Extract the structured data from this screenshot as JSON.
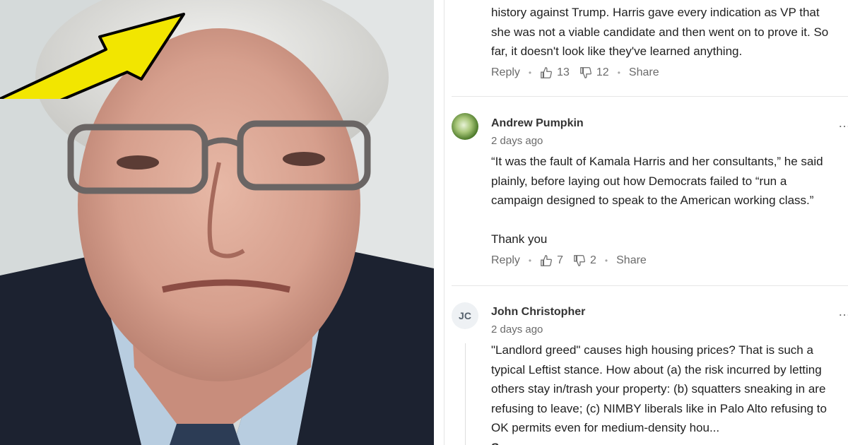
{
  "comments": [
    {
      "text_lines": [
        "history against Trump. Harris gave every indication as VP that",
        "she was not a viable candidate and then went on to prove it. So",
        "far, it doesn't look like they've learned anything."
      ],
      "reply_label": "Reply",
      "likes": "13",
      "dislikes": "12",
      "share_label": "Share"
    },
    {
      "author": "Andrew Pumpkin",
      "time": "2 days ago",
      "text_lines": [
        "“It was the fault of Kamala Harris and her consultants,” he said",
        "plainly, before laying out how Democrats failed to “run a",
        "campaign designed to speak to the American working class.”"
      ],
      "text_extra": "Thank you",
      "reply_label": "Reply",
      "likes": "7",
      "dislikes": "2",
      "share_label": "Share",
      "more_label": "…"
    },
    {
      "author": "John Christopher",
      "initials": "JC",
      "time": "2 days ago",
      "text_lines": [
        "\"Landlord greed\" causes high housing prices? That is such a",
        "typical Leftist stance. How about (a) the risk incurred by letting",
        "others stay in/trash your property: (b) squatters sneaking in are",
        "refusing to leave; (c) NIMBY liberals like in Palo Alto refusing to",
        "OK permits even for medium-density hou..."
      ],
      "see_more_label": "See more",
      "more_label": "…"
    }
  ],
  "colors": {
    "arrow": "#f2e600",
    "text": "#1f1f1f",
    "muted": "#6b6b6b"
  }
}
